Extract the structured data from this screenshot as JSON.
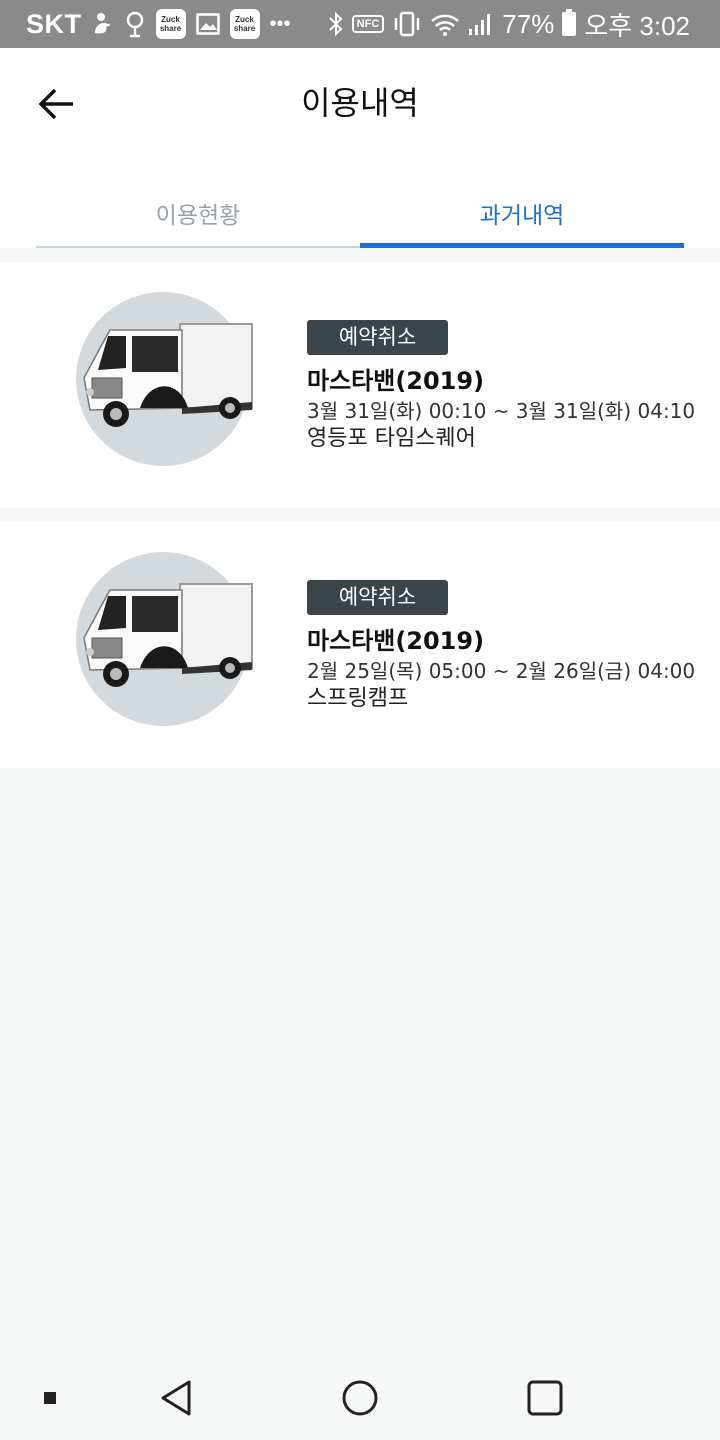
{
  "status_bar": {
    "carrier": "SKT",
    "app_badge_1": "Zuck share",
    "app_badge_2": "Zuck share",
    "more": "•••",
    "nfc": "NFC",
    "battery_percent": "77%",
    "time": "오후 3:02"
  },
  "header": {
    "title": "이용내역",
    "back_icon": "arrow-left-icon"
  },
  "tabs": [
    {
      "label": "이용현황",
      "active": false
    },
    {
      "label": "과거내역",
      "active": true
    }
  ],
  "history": [
    {
      "status": "예약취소",
      "car_name": "마스타밴(2019)",
      "period": "3월 31일(화) 00:10 ~ 3월 31일(화) 04:10",
      "location": "영등포 타임스퀘어"
    },
    {
      "status": "예약취소",
      "car_name": "마스타밴(2019)",
      "period": "2월 25일(목) 05:00 ~ 2월 26일(금) 04:00",
      "location": "스프링캠프"
    }
  ],
  "nav_bar": {
    "icons": [
      "recents-dot-icon",
      "back-triangle-icon",
      "home-circle-icon",
      "overview-square-icon"
    ]
  },
  "colors": {
    "accent": "#1f6fd9",
    "badge_bg": "#3a4449",
    "status_bar_bg": "#8a8a8a",
    "page_bg": "#f6f7f7"
  }
}
